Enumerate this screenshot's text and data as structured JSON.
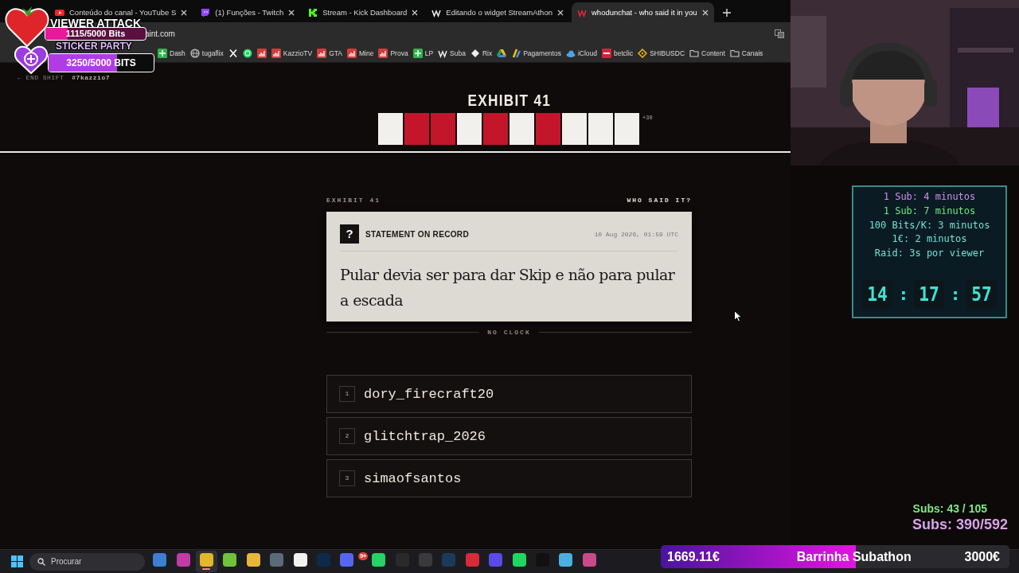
{
  "browser": {
    "tabs": [
      {
        "title": "Conteúdo do canal - YouTube S",
        "kind": "youtube",
        "selected": false
      },
      {
        "title": "(1) Funções - Twitch",
        "kind": "twitch",
        "selected": false
      },
      {
        "title": "Stream - Kick Dashboard",
        "kind": "kick",
        "selected": false
      },
      {
        "title": "Editando o widget StreamAthon",
        "kind": "w",
        "selected": false
      },
      {
        "title": "whodunchat - who said it in you",
        "kind": "wred",
        "selected": true
      }
    ],
    "address": "aint.com",
    "bookmarks": [
      {
        "label": "Dash",
        "kind": "sheet"
      },
      {
        "label": "tugaflix",
        "kind": "globe"
      },
      {
        "kind": "x"
      },
      {
        "kind": "chat"
      },
      {
        "kind": "chart"
      },
      {
        "label": "KazzioTV",
        "kind": "chart"
      },
      {
        "label": "GTA",
        "kind": "chart"
      },
      {
        "label": "Mine",
        "kind": "chart"
      },
      {
        "label": "Prova",
        "kind": "chart"
      },
      {
        "label": "LP",
        "kind": "sheet"
      },
      {
        "label": "Suba",
        "kind": "w"
      },
      {
        "label": "Rix",
        "kind": "diamond"
      },
      {
        "kind": "drive"
      },
      {
        "label": "Pagamentos",
        "kind": "pen"
      },
      {
        "label": "iCloud",
        "kind": "cloud"
      },
      {
        "label": "betclic",
        "kind": "card"
      },
      {
        "label": "SHIBUSDC",
        "kind": "coin"
      },
      {
        "label": "Content",
        "kind": "folder"
      },
      {
        "label": "Canais",
        "kind": "folder"
      }
    ]
  },
  "exhibit": {
    "back_link": "← END SHIFT",
    "handle": "#7kazzio7",
    "title": "EXHIBIT 41",
    "marks": [
      {
        "color": "#f2f0ec"
      },
      {
        "color": "#c3162b"
      },
      {
        "color": "#c3162b"
      },
      {
        "color": "#f2f0ec"
      },
      {
        "color": "#c3162b"
      },
      {
        "color": "#f2f0ec"
      },
      {
        "color": "#c3162b"
      },
      {
        "color": "#f2f0ec"
      },
      {
        "color": "#f2f0ec"
      },
      {
        "color": "#f2f0ec"
      }
    ],
    "bonus": "+30",
    "card_label": "EXHIBIT 41",
    "card_prompt": "WHO SAID IT?",
    "card": {
      "badge": "?",
      "heading": "STATEMENT ON RECORD",
      "timestamp": "10 Aug 2026, 01:59 UTC",
      "quote": "Pular devia ser para dar Skip e não para pular a escada"
    },
    "clock_note": "NO CLOCK",
    "options": [
      {
        "number": "1",
        "name": "dory_firecraft20"
      },
      {
        "number": "2",
        "name": "glitchtrap_2026"
      },
      {
        "number": "3",
        "name": "simaofsantos"
      }
    ]
  },
  "goals": [
    {
      "kind": "tomato",
      "title": "VIEWER ATTACK",
      "reading": "1115/5000 Bits",
      "level": 0.22,
      "color": "#e8199c"
    },
    {
      "kind": "plus",
      "title": "STICKER PARTY",
      "reading": "3250/5000 BITS",
      "level": 0.65,
      "color": "#b13ce6"
    }
  ],
  "timer": {
    "rules": [
      {
        "text": "1 Sub: 4 minutos",
        "color": "#d28ee6"
      },
      {
        "text": "1 Sub: 7 minutos",
        "color": "#6ee87c"
      },
      {
        "text": "100 Bits/K: 3 minutos",
        "color": "#6fe3d6"
      },
      {
        "text": "1€: 2 minutos",
        "color": "#6fe3d6"
      },
      {
        "text": "Raid: 3s por viewer",
        "color": "#6fe3d6"
      }
    ],
    "clock": [
      "14",
      ":",
      "17",
      ":",
      "57"
    ]
  },
  "sub_counts": [
    {
      "text": "Subs: 43 / 105",
      "color": "#7ee884"
    },
    {
      "text": "Subs: 390/592",
      "color": "#d8a2e8"
    }
  ],
  "subathon": {
    "current": "1669.11€",
    "title": "Barrinha Subathon",
    "goal": "3000€",
    "level": 0.56
  },
  "taskbar": {
    "search_placeholder": "Procurar",
    "apps": [
      {
        "color": "#3c7fd0",
        "selected": false
      },
      {
        "color": "#c23aa8",
        "selected": false
      },
      {
        "color": "#e3b62b",
        "selected": true
      },
      {
        "color": "#6fc23a",
        "selected": false
      },
      {
        "color": "#e8b73a",
        "selected": false
      },
      {
        "color": "#5a6a7a",
        "selected": false
      },
      {
        "color": "#f2f2f2",
        "selected": false
      },
      {
        "color": "#0d2a4a",
        "selected": false
      },
      {
        "color": "#5865f2",
        "selected": false,
        "badge": "9+"
      },
      {
        "color": "#25d366",
        "selected": false
      },
      {
        "color": "#2a2a2a",
        "selected": false
      },
      {
        "color": "#3a3a3a",
        "selected": false
      },
      {
        "color": "#1b3a5a",
        "selected": false
      },
      {
        "color": "#d92a3a",
        "selected": false
      },
      {
        "color": "#5a4ae8",
        "selected": false
      },
      {
        "color": "#1ed760",
        "selected": false
      },
      {
        "color": "#111111",
        "selected": false
      },
      {
        "color": "#4ab0e0",
        "selected": false
      },
      {
        "color": "#c84a8a",
        "selected": false
      }
    ]
  }
}
